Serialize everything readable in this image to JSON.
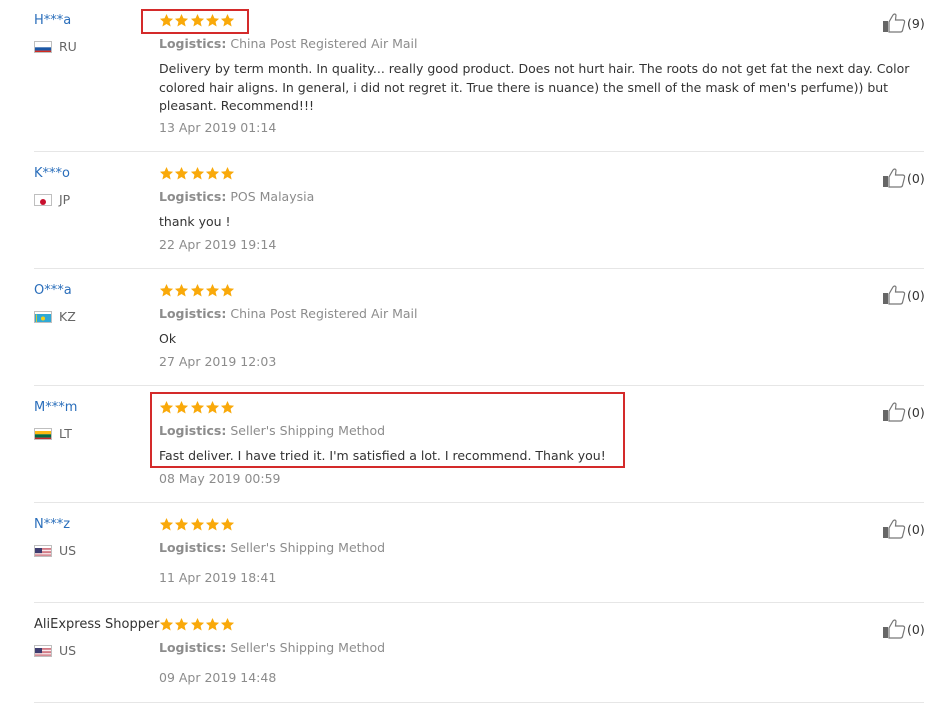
{
  "logistics_label": "Logistics:",
  "star_color": "#f9a90a",
  "highlight_color": "#d42a2a",
  "user_link_color": "#2a6ebb",
  "icons": {
    "rating": "star-icon",
    "helpful": "thumbs-up-icon",
    "country": "flag-icon"
  },
  "reviews": [
    {
      "user": "H***a",
      "country": "RU",
      "rating": 5,
      "logistics": "China Post Registered Air Mail",
      "text": "Delivery by term month. In quality... really good product. Does not hurt hair. The roots do not get fat the next day. Color colored hair aligns. In general, i did not regret it. True there is nuance) the smell of the mask of men's perfume)) but pleasant. Recommend!!!",
      "date": "13 Apr 2019 01:14",
      "helpful": "(9)"
    },
    {
      "user": "K***o",
      "country": "JP",
      "rating": 5,
      "logistics": "POS Malaysia",
      "text": "thank you !",
      "date": "22 Apr 2019 19:14",
      "helpful": "(0)"
    },
    {
      "user": "O***a",
      "country": "KZ",
      "rating": 5,
      "logistics": "China Post Registered Air Mail",
      "text": "Ok",
      "date": "27 Apr 2019 12:03",
      "helpful": "(0)"
    },
    {
      "user": "M***m",
      "country": "LT",
      "rating": 5,
      "logistics": "Seller's Shipping Method",
      "text": "Fast deliver. I have tried it. I'm satisfied a lot. I recommend. Thank you!",
      "date": "08 May 2019 00:59",
      "helpful": "(0)"
    },
    {
      "user": "N***z",
      "country": "US",
      "rating": 5,
      "logistics": "Seller's Shipping Method",
      "text": "",
      "date": "11 Apr 2019 18:41",
      "helpful": "(0)"
    },
    {
      "user": "AliExpress Shopper",
      "country": "US",
      "rating": 5,
      "logistics": "Seller's Shipping Method",
      "text": "",
      "date": "09 Apr 2019 14:48",
      "helpful": "(0)"
    }
  ]
}
